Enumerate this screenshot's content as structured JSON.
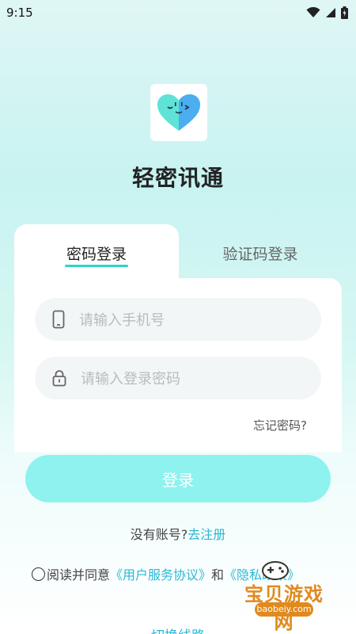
{
  "status_bar": {
    "time": "9:15"
  },
  "app": {
    "title": "轻密讯通"
  },
  "tabs": [
    {
      "label": "密码登录",
      "active": true
    },
    {
      "label": "验证码登录",
      "active": false
    }
  ],
  "form": {
    "phone_placeholder": "请输入手机号",
    "password_placeholder": "请输入登录密码",
    "forgot_label": "忘记密码?",
    "login_label": "登录"
  },
  "register": {
    "prompt": "没有账号?",
    "link": "去注册"
  },
  "agreement": {
    "prefix": "阅读并同意",
    "user_agreement": "《用户服务协议》",
    "and": "和",
    "privacy_policy": "《隐私政策》"
  },
  "switch_line_label": "切换线路",
  "watermark": {
    "text": "宝贝游戏网",
    "url": "baobeiy.com"
  },
  "colors": {
    "accent": "#2dd4c8",
    "button": "#8ef2ef",
    "link": "#2bb8d6"
  }
}
